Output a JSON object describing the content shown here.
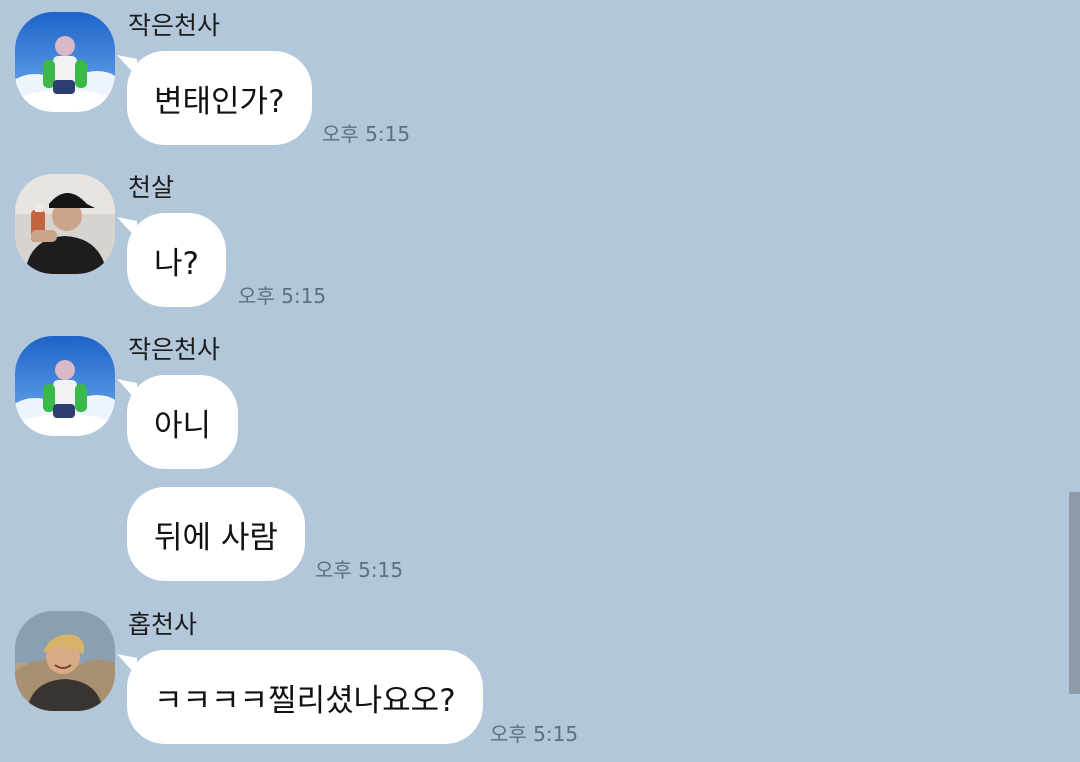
{
  "messages": [
    {
      "sender": "작은천사",
      "avatar_icon": "angel-sky-avatar-icon",
      "bubbles": [
        {
          "text": "변태인가?",
          "time": "오후 5:15"
        }
      ]
    },
    {
      "sender": "천살",
      "avatar_icon": "cap-person-avatar-icon",
      "bubbles": [
        {
          "text": "나?",
          "time": "오후 5:15"
        }
      ]
    },
    {
      "sender": "작은천사",
      "avatar_icon": "angel-sky-avatar-icon",
      "bubbles": [
        {
          "text": "아니",
          "time": ""
        },
        {
          "text": "뒤에 사람",
          "time": "오후 5:15"
        }
      ]
    },
    {
      "sender": "홉천사",
      "avatar_icon": "smiling-person-avatar-icon",
      "bubbles": [
        {
          "text": "ㅋㅋㅋㅋ찔리셨나요오?",
          "time": "오후 5:15"
        }
      ]
    }
  ],
  "colors": {
    "background": "#b2c7da",
    "bubble": "#ffffff",
    "time_text": "#5f6f7e",
    "scrollbar": "#8d9ba8"
  }
}
